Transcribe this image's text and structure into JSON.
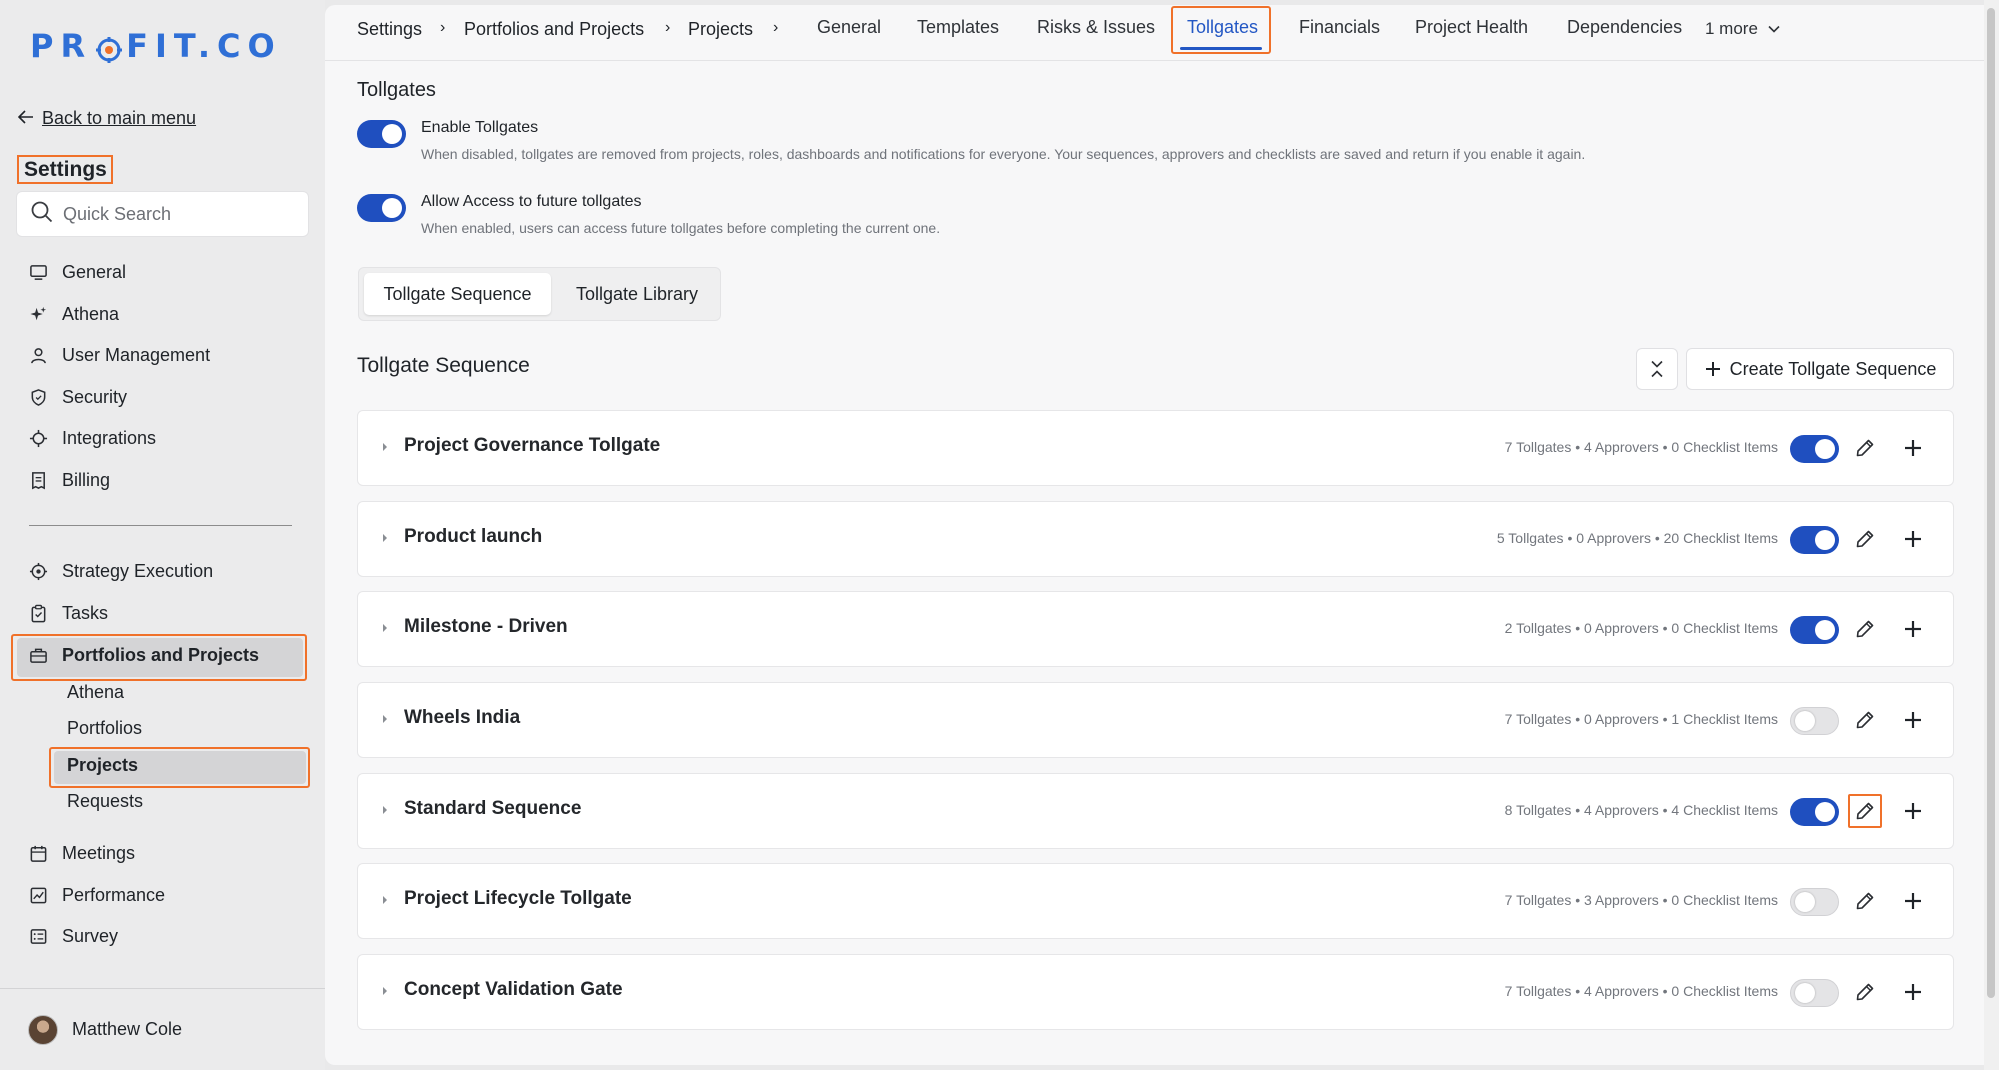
{
  "brand": {
    "logo_text": "PROFIT.CO",
    "accent": "#2f6fd6",
    "highlight": "#f0712a",
    "toggle_on": "#1f4fbf"
  },
  "sidebar": {
    "back_label": "Back to main menu",
    "heading": "Settings",
    "search_placeholder": "Quick Search",
    "items": [
      {
        "label": "General",
        "icon": "monitor-icon"
      },
      {
        "label": "Athena",
        "icon": "sparkle-icon"
      },
      {
        "label": "User Management",
        "icon": "user-icon"
      },
      {
        "label": "Security",
        "icon": "shield-icon"
      },
      {
        "label": "Integrations",
        "icon": "plug-icon"
      },
      {
        "label": "Billing",
        "icon": "receipt-icon"
      }
    ],
    "items2": [
      {
        "label": "Strategy Execution",
        "icon": "target-icon"
      },
      {
        "label": "Tasks",
        "icon": "clipboard-check-icon"
      },
      {
        "label": "Portfolios and Projects",
        "icon": "briefcase-icon"
      }
    ],
    "sub_items": [
      "Athena",
      "Portfolios",
      "Projects",
      "Requests"
    ],
    "items3": [
      {
        "label": "Meetings",
        "icon": "calendar-icon"
      },
      {
        "label": "Performance",
        "icon": "chart-icon"
      },
      {
        "label": "Survey",
        "icon": "survey-icon"
      }
    ],
    "user_name": "Matthew Cole"
  },
  "topbar": {
    "breadcrumb": [
      "Settings",
      "Portfolios and Projects",
      "Projects"
    ],
    "tabs": [
      "General",
      "Templates",
      "Risks & Issues",
      "Tollgates",
      "Financials",
      "Project Health",
      "Dependencies"
    ],
    "active_tab": "Tollgates",
    "more_label": "1 more"
  },
  "page": {
    "title": "Tollgates",
    "settings": [
      {
        "label": "Enable Tollgates",
        "desc": "When disabled, tollgates are removed from projects, roles, dashboards and notifications for everyone. Your sequences, approvers and checklists are saved and return if you enable it again.",
        "enabled": true
      },
      {
        "label": "Allow Access to future tollgates",
        "desc": "When enabled, users can access future tollgates before completing the current one.",
        "enabled": true
      }
    ],
    "segments": [
      "Tollgate Sequence",
      "Tollgate Library"
    ],
    "active_segment": "Tollgate Sequence",
    "section_title": "Tollgate Sequence",
    "create_label": "Create Tollgate Sequence",
    "sequences": [
      {
        "name": "Project Governance Tollgate",
        "meta": "7 Tollgates • 4 Approvers • 0 Checklist Items",
        "enabled": true
      },
      {
        "name": "Product launch",
        "meta": "5 Tollgates • 0 Approvers • 20 Checklist Items",
        "enabled": true
      },
      {
        "name": "Milestone - Driven",
        "meta": "2 Tollgates • 0 Approvers • 0 Checklist Items",
        "enabled": true
      },
      {
        "name": "Wheels India",
        "meta": "7 Tollgates • 0 Approvers • 1 Checklist Items",
        "enabled": false
      },
      {
        "name": "Standard Sequence",
        "meta": "8 Tollgates • 4 Approvers • 4 Checklist Items",
        "enabled": true
      },
      {
        "name": "Project Lifecycle Tollgate",
        "meta": "7 Tollgates • 3 Approvers • 0 Checklist Items",
        "enabled": false
      },
      {
        "name": "Concept Validation Gate",
        "meta": "7 Tollgates • 4 Approvers • 0 Checklist Items",
        "enabled": false
      }
    ]
  }
}
